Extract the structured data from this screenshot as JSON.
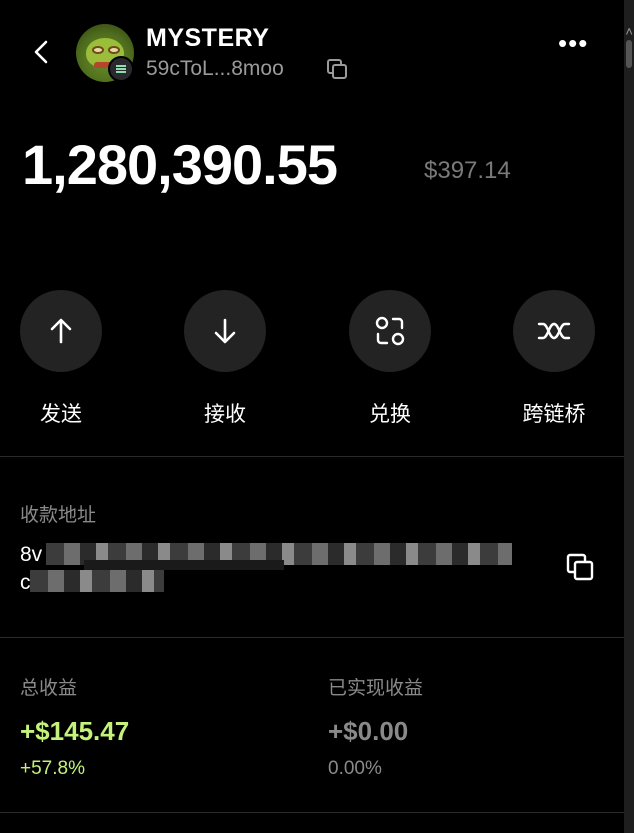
{
  "header": {
    "wallet_name": "MYSTERY",
    "wallet_address_short": "59cToL...8moo",
    "avatar_icon": "pepe-avatar-icon",
    "chain_icon": "solana-icon"
  },
  "balance": {
    "amount": "1,280,390.55",
    "usd_value": "$397.14"
  },
  "actions": [
    {
      "label": "发送",
      "icon": "arrow-up-icon"
    },
    {
      "label": "接收",
      "icon": "arrow-down-icon"
    },
    {
      "label": "兑换",
      "icon": "swap-icon"
    },
    {
      "label": "跨链桥",
      "icon": "bridge-icon"
    }
  ],
  "receive_address": {
    "label": "收款地址",
    "line1_visible": "8v",
    "line2_visible": "c"
  },
  "stats": {
    "total_label": "总收益",
    "total_value": "+$145.47",
    "total_pct": "+57.8%",
    "realized_label": "已实现收益",
    "realized_value": "+$0.00",
    "realized_pct": "0.00%"
  },
  "colors": {
    "background": "#000000",
    "positive": "#c4f27a",
    "muted": "#8a8a8a",
    "button_bg": "#232323"
  }
}
